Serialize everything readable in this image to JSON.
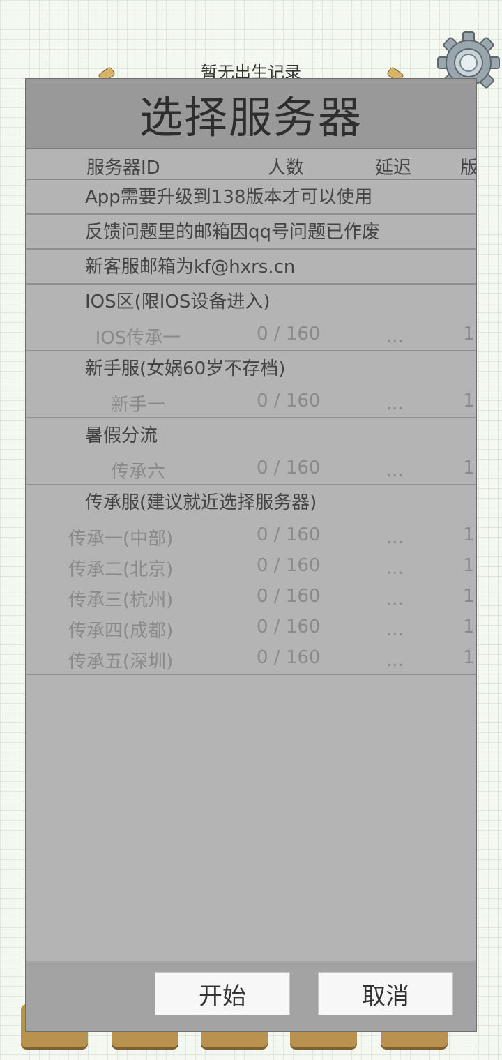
{
  "background": {
    "title": "暂无出生记录"
  },
  "dialog": {
    "title": "选择服务器",
    "columns": {
      "id": "服务器ID",
      "count": "人数",
      "ping": "延迟",
      "version": "版"
    },
    "notices": [
      "App需要升级到138版本才可以使用",
      "反馈问题里的邮箱因qq号问题已作废",
      "新客服邮箱为kf@hxrs.cn"
    ],
    "groups": [
      {
        "title": "IOS区(限IOS设备进入)",
        "servers": [
          {
            "name": "IOS传承一",
            "count": "0 / 160",
            "ping": "...",
            "version": "1"
          }
        ]
      },
      {
        "title": "新手服(女娲60岁不存档)",
        "servers": [
          {
            "name": "新手一",
            "count": "0 / 160",
            "ping": "...",
            "version": "1"
          }
        ]
      },
      {
        "title": "暑假分流",
        "servers": [
          {
            "name": "传承六",
            "count": "0 / 160",
            "ping": "...",
            "version": "1"
          }
        ]
      },
      {
        "title": "传承服(建议就近选择服务器)",
        "servers": [
          {
            "name": "传承一(中部)",
            "count": "0 / 160",
            "ping": "...",
            "version": "1"
          },
          {
            "name": "传承二(北京)",
            "count": "0 / 160",
            "ping": "...",
            "version": "1"
          },
          {
            "name": "传承三(杭州)",
            "count": "0 / 160",
            "ping": "...",
            "version": "1"
          },
          {
            "name": "传承四(成都)",
            "count": "0 / 160",
            "ping": "...",
            "version": "1"
          },
          {
            "name": "传承五(深圳)",
            "count": "0 / 160",
            "ping": "...",
            "version": "1"
          }
        ]
      }
    ],
    "buttons": {
      "start": "开始",
      "cancel": "取消"
    }
  },
  "icons": {
    "settings": "gear-icon"
  },
  "colors": {
    "dialog_bg": "#b4b4b4",
    "header_bg": "#999999",
    "footer_bg": "#a3a3a3",
    "tab_bg": "#b8924e"
  }
}
